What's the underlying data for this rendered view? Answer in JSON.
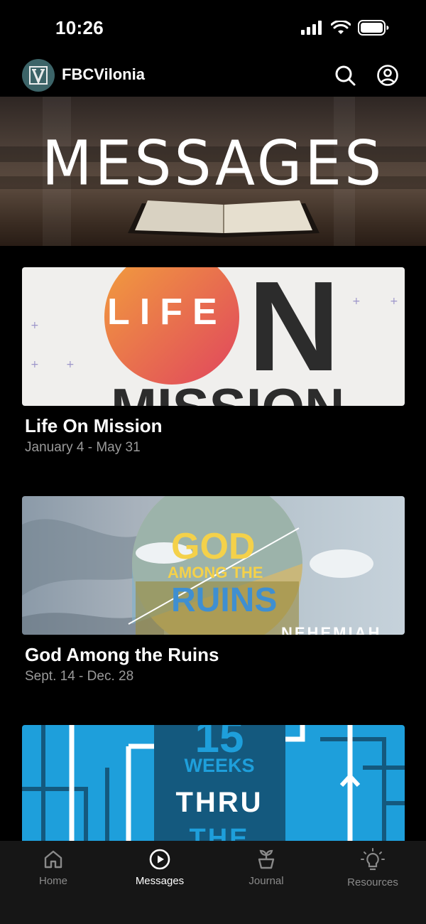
{
  "status_bar": {
    "time": "10:26"
  },
  "header": {
    "app_name": "FBCVilonia",
    "logo_letter": "V",
    "search_icon": "search-icon",
    "account_icon": "account-icon"
  },
  "hero": {
    "title": "MESSAGES"
  },
  "series": [
    {
      "title": "Life On Mission",
      "dates": "January 4 - May 31",
      "art_text": [
        "LIFE",
        "N",
        "MISSION"
      ]
    },
    {
      "title": "God Among the Ruins",
      "dates": "Sept. 14 - Dec. 28",
      "art_text": [
        "GOD",
        "AMONG THE",
        "RUINS",
        "NEHEMIAH"
      ]
    },
    {
      "title": "",
      "dates": "",
      "art_text": [
        "15",
        "WEEKS",
        "THRU",
        "THE"
      ]
    }
  ],
  "tabs": [
    {
      "label": "Home",
      "icon": "home-icon",
      "active": false
    },
    {
      "label": "Messages",
      "icon": "play-circle-icon",
      "active": true
    },
    {
      "label": "Journal",
      "icon": "plant-icon",
      "active": false
    },
    {
      "label": "Resources",
      "icon": "lightbulb-icon",
      "active": false
    }
  ],
  "colors": {
    "background": "#000000",
    "tab_bar": "#161616",
    "inactive_tab": "#8a8a8a",
    "accent_blue": "#1e9fdb"
  }
}
